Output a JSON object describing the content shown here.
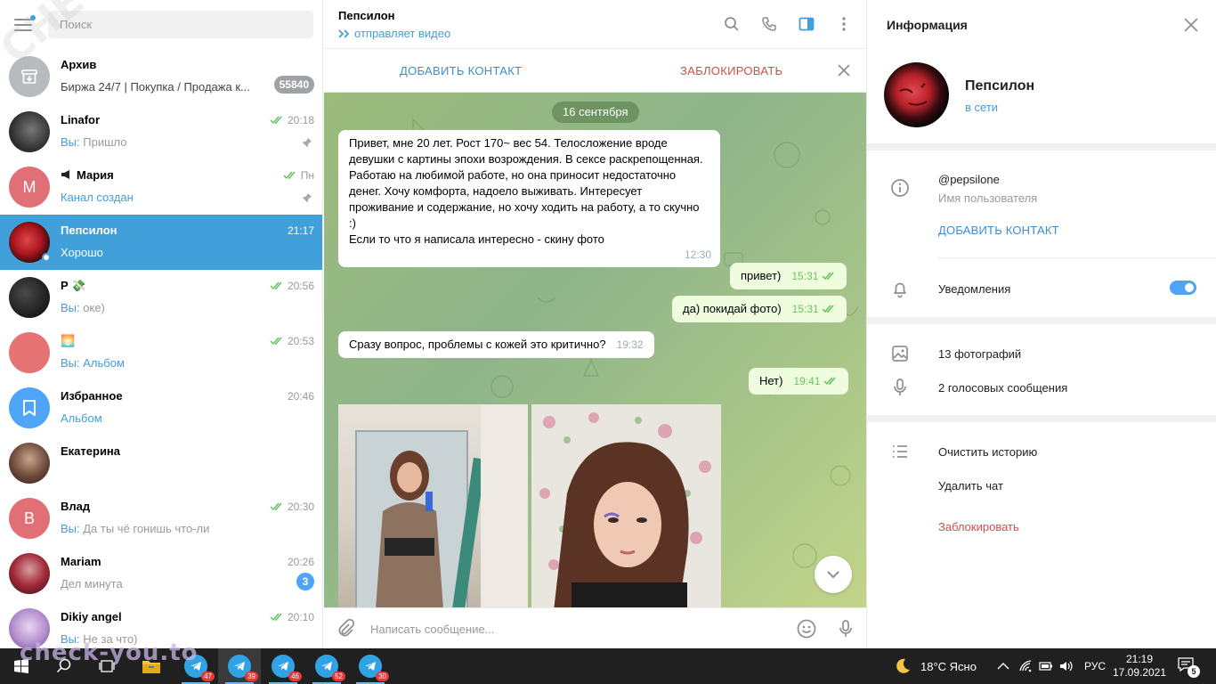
{
  "search": {
    "placeholder": "Поиск"
  },
  "chats": [
    {
      "name": "Архив",
      "preview": "Биржа 24/7 | Покупка / Продажа к...",
      "time": "",
      "badge": "55840"
    },
    {
      "name": "Linafor",
      "you": "Вы: ",
      "preview": "Пришло",
      "time": "20:18"
    },
    {
      "name": "Мария",
      "preview": "Канал создан",
      "time": "Пн",
      "avatar_letter": "М"
    },
    {
      "name": "Пепсилон",
      "preview": "Хорошо",
      "time": "21:17"
    },
    {
      "name": "Р 💸",
      "you": "Вы: ",
      "preview": "оке)",
      "time": "20:56"
    },
    {
      "name": "🌅",
      "you": "Вы: ",
      "preview": "Альбом",
      "time": "20:53"
    },
    {
      "name": "Избранное",
      "preview": "Альбом",
      "time": "20:46"
    },
    {
      "name": "Екатерина",
      "preview": "",
      "time": ""
    },
    {
      "name": "Влад",
      "you": "Вы: ",
      "preview": "Да ты чё гонишь что-ли",
      "time": "20:30",
      "avatar_letter": "В"
    },
    {
      "name": "Mariam",
      "preview": "Дел минута",
      "time": "20:26",
      "badge": "3"
    },
    {
      "name": "Dikiy angel",
      "you": "Вы: ",
      "preview": "Не за что)",
      "time": "20:10"
    }
  ],
  "header": {
    "title": "Пепсилон",
    "status": "отправляет видео"
  },
  "actionbar": {
    "add": "ДОБАВИТЬ КОНТАКТ",
    "block": "ЗАБЛОКИРОВАТЬ"
  },
  "date_pill": "16 сентября",
  "messages": {
    "m1_text": "Привет, мне 20 лет. Рост 170~ вес 54. Телосложение вроде девушки с картины эпохи возрождения. В сексе раскрепощенная. Работаю на любимой работе, но она приносит недостаточно денег. Хочу комфорта, надоело выживать. Интересует проживание и содержание, но хочу ходить на работу, а то скучно :)",
    "m1_text2": "Если то что я написала интересно - скину фото",
    "m1_time": "12:30",
    "m2_text": "привет)",
    "m2_time": "15:31",
    "m3_text": "да) покидай фото)",
    "m3_time": "15:31",
    "m4_text": "Сразу вопрос, проблемы с кожей это критично?",
    "m4_time": "19:32",
    "m5_text": "Нет)",
    "m5_time": "19:41"
  },
  "compose": {
    "placeholder": "Написать сообщение..."
  },
  "info": {
    "title": "Информация",
    "name": "Пепсилон",
    "status": "в сети",
    "username": "@pepsilone",
    "username_label": "Имя пользователя",
    "add_contact": "ДОБАВИТЬ КОНТАКТ",
    "notifications": "Уведомления",
    "notifications_on": true,
    "photos": "13 фотографий",
    "voice": "2 голосовых сообщения",
    "clear": "Очистить историю",
    "delete": "Удалить чат",
    "block": "Заблокировать"
  },
  "taskbar": {
    "weather": "18°C Ясно",
    "lang": "РУС",
    "time": "21:19",
    "date": "17.09.2021",
    "notif_count": "5",
    "tg_counts": [
      "47",
      "39",
      "46",
      "52",
      "30"
    ]
  },
  "watermark": "check-you.to",
  "diag_watermark": "CHECK-YOU.ME",
  "colors": {
    "accent": "#419fd9",
    "danger": "#d14e4e",
    "out_bubble": "#effdde"
  }
}
